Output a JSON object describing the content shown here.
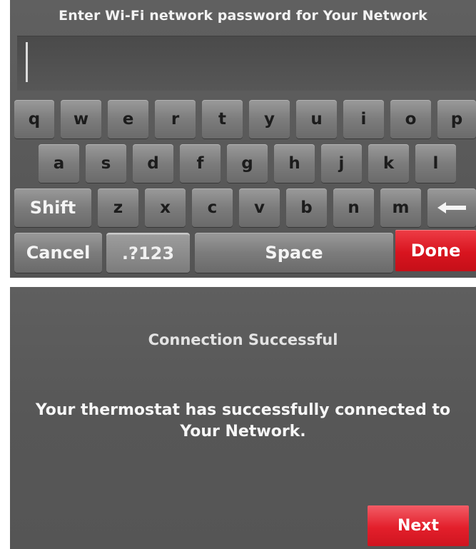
{
  "keyboard_screen": {
    "prompt": "Enter Wi-Fi network password for Your Network",
    "password_value": "",
    "rows": [
      [
        "q",
        "w",
        "e",
        "r",
        "t",
        "y",
        "u",
        "i",
        "o",
        "p"
      ],
      [
        "a",
        "s",
        "d",
        "f",
        "g",
        "h",
        "j",
        "k",
        "l"
      ],
      [
        "Shift",
        "z",
        "x",
        "c",
        "v",
        "b",
        "n",
        "m"
      ]
    ],
    "backspace_icon": "backspace-arrow-icon",
    "bottom_row": {
      "cancel": "Cancel",
      "symbols": ".?123",
      "space": "Space",
      "done": "Done"
    }
  },
  "success_screen": {
    "title": "Connection Successful",
    "message_line1": "Your thermostat has successfully connected to",
    "message_line2": "Your Network.",
    "next": "Next"
  },
  "colors": {
    "accent_red": "#d8141f",
    "screen_bg": "#5a5a5a",
    "key_bg": "#7c7c7c"
  }
}
